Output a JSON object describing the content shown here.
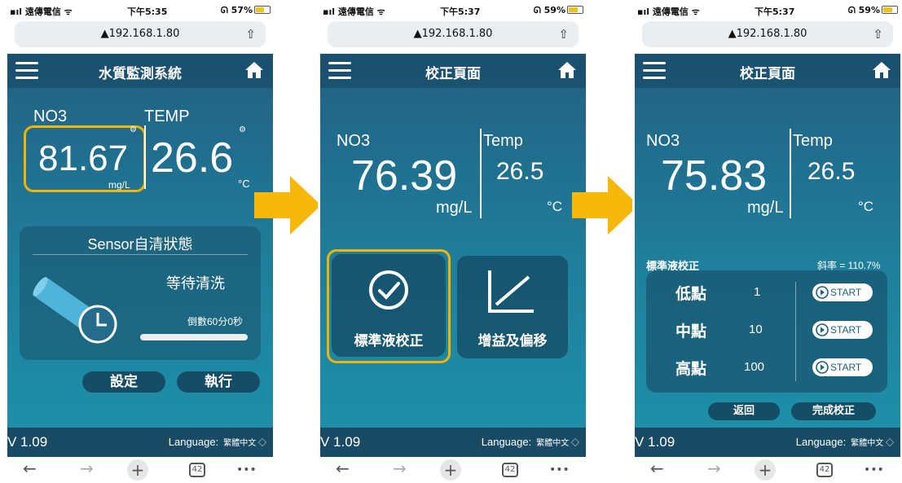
{
  "common": {
    "signal": "▪ıl 遠傳電信 ᯤ",
    "url": "▲192.168.1.80",
    "version": "V 1.09",
    "language_label": "Language:",
    "language_value": "繁體中文 ◇",
    "tabs_count": "42"
  },
  "screen1": {
    "time": "下午5:35",
    "battery": "57%",
    "title": "水質監測系統",
    "no3_label": "NO3",
    "no3_value": "81.67",
    "no3_unit": "mg/L",
    "temp_label": "TEMP",
    "temp_value": "26.6",
    "temp_unit": "°C",
    "clean_title": "Sensor自清狀態",
    "clean_status": "等待清洗",
    "countdown": "倒數60分0秒",
    "settings_button": "設定",
    "run_button": "執行"
  },
  "screen2": {
    "time": "下午5:37",
    "battery": "59%",
    "title": "校正頁面",
    "no3_label": "NO3",
    "no3_value": "76.39",
    "no3_unit": "mg/L",
    "temp_label": "Temp",
    "temp_value": "26.5",
    "temp_unit": "°C",
    "std_button": "標準液校正",
    "gain_button": "增益及偏移"
  },
  "screen3": {
    "time": "下午5:37",
    "battery": "59%",
    "title": "校正頁面",
    "no3_label": "NO3",
    "no3_value": "75.83",
    "no3_unit": "mg/L",
    "temp_label": "Temp",
    "temp_value": "26.5",
    "temp_unit": "°C",
    "section_label": "標準液校正",
    "slope": "斜率 = 110.7%",
    "rows": [
      {
        "label": "低點",
        "value": "1",
        "button": "START"
      },
      {
        "label": "中點",
        "value": "10",
        "button": "START"
      },
      {
        "label": "高點",
        "value": "100",
        "button": "START"
      }
    ],
    "back_button": "返回",
    "finish_button": "完成校正"
  },
  "colors": {
    "accent": "#f2b400",
    "app_bg_top": "#225f82",
    "app_bg_bottom": "#1e8fa7",
    "footer": "#194b64"
  }
}
